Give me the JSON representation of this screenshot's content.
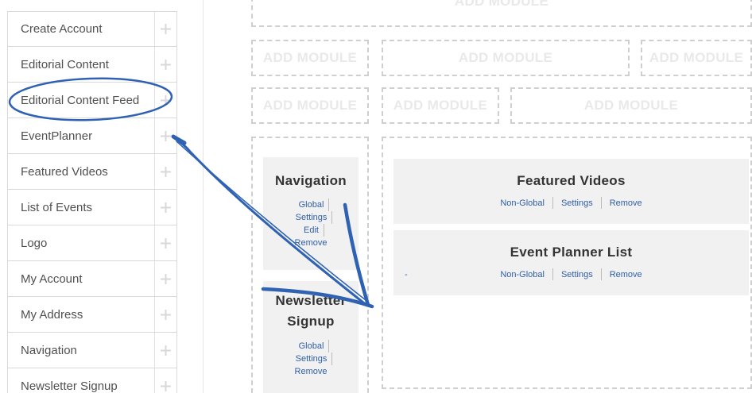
{
  "sidebar": {
    "items": [
      {
        "label": "Create Account"
      },
      {
        "label": "Editorial Content"
      },
      {
        "label": "Editorial Content Feed"
      },
      {
        "label": "EventPlanner"
      },
      {
        "label": "Featured Videos"
      },
      {
        "label": "List of Events"
      },
      {
        "label": "Logo"
      },
      {
        "label": "My Account"
      },
      {
        "label": "My Address"
      },
      {
        "label": "Navigation"
      },
      {
        "label": "Newsletter Signup"
      }
    ],
    "handle_icon": "drag-move-icon"
  },
  "zones": {
    "add_module_label": "ADD MODULE"
  },
  "modules": {
    "navigation": {
      "title": "Navigation",
      "links": [
        "Global",
        "Settings",
        "Edit",
        "Remove"
      ]
    },
    "newsletter": {
      "title_line1": "Newsletter",
      "title_line2": "Signup",
      "links": [
        "Global",
        "Settings",
        "Remove"
      ]
    },
    "featured_videos": {
      "title": "Featured Videos",
      "links": [
        "Non-Global",
        "Settings",
        "Remove"
      ]
    },
    "event_planner_list": {
      "title": "Event Planner List",
      "dot": "-",
      "links": [
        "Non-Global",
        "Settings",
        "Remove"
      ]
    }
  },
  "annotation": {
    "color": "#2f62b3"
  }
}
